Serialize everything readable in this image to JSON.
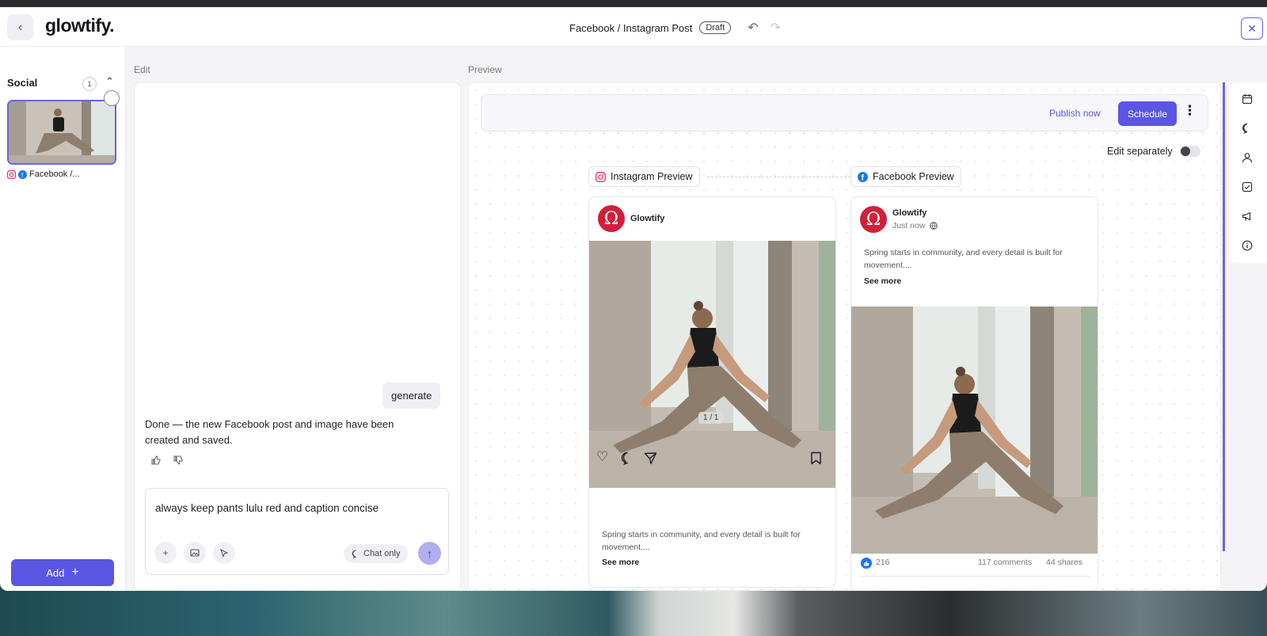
{
  "header": {
    "logo": "glowtify.",
    "doc_title": "Facebook / Instagram Post",
    "status_badge": "Draft",
    "back_icon": "‹",
    "undo_icon": "↶",
    "redo_icon": "↷",
    "close_icon": "✕"
  },
  "sidebar": {
    "section_title": "Social",
    "count": "1",
    "caret": "⌃",
    "item_label": "Facebook /...",
    "add_label": "Add",
    "add_icon": "+"
  },
  "labels": {
    "edit": "Edit",
    "preview": "Preview"
  },
  "chat": {
    "user_message": "generate",
    "assistant_message": "Done — the new Facebook post and image have been created and saved.",
    "input_value": "always keep pants lulu red and caption concise",
    "chat_only_label": "Chat only",
    "plus_icon": "+",
    "send_icon": "↑"
  },
  "preview": {
    "publish_now": "Publish now",
    "schedule": "Schedule",
    "more_icon": "⋮",
    "edit_separately": "Edit separately",
    "edit_separately_on": false,
    "instagram_tag": "Instagram Preview",
    "facebook_tag": "Facebook Preview",
    "instagram": {
      "account": "Glowtify",
      "counter": "1 / 1",
      "caption": "Spring starts in community, and every detail is built for movement....",
      "see_more": "See more"
    },
    "facebook": {
      "account": "Glowtify",
      "time": "Just now",
      "caption": "Spring starts in community, and every detail is built for movement....",
      "see_more": "See more",
      "likes": "216",
      "comments": "117 comments",
      "shares": "44 shares"
    }
  },
  "colors": {
    "accent": "#5b55e3",
    "brand_red": "#d21f3c"
  }
}
